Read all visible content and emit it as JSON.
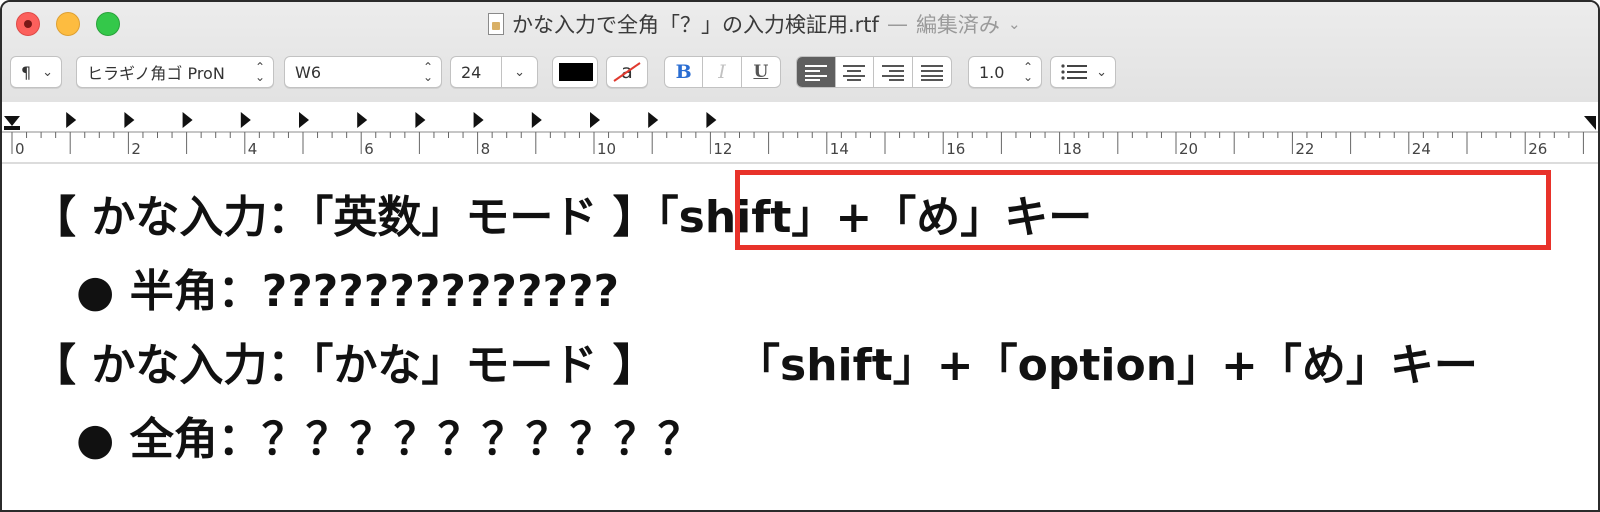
{
  "window": {
    "title": "かな入力で全角「？」の入力検証用.rtf",
    "separator": "—",
    "edited_label": "編集済み"
  },
  "toolbar": {
    "paragraph_style": "¶",
    "font_family": "ヒラギノ角ゴ ProN",
    "font_weight": "W6",
    "font_size": "24",
    "highlight_glyph": "a",
    "bold": "B",
    "italic": "I",
    "underline": "U",
    "line_spacing": "1.0",
    "text_color": "#000000"
  },
  "ruler": {
    "labels": [
      "0",
      "2",
      "4",
      "6",
      "8",
      "10",
      "12",
      "14",
      "16",
      "18",
      "20",
      "22",
      "24",
      "26"
    ]
  },
  "document": {
    "line1": "【 かな入力：「英数」モード 】「shift」+「め」キー",
    "line2": "　● 半角：??????????????",
    "line3_left": "【 かな入力：「かな」モード 】",
    "line3_right": "「shift」+「option」+「め」キー",
    "line4": "　● 全角：？？？？？？？？？？"
  },
  "colors": {
    "highlight_box": "#e8322a",
    "close": "#fc605c",
    "minimize": "#fdbc40",
    "maximize": "#34c84a"
  }
}
